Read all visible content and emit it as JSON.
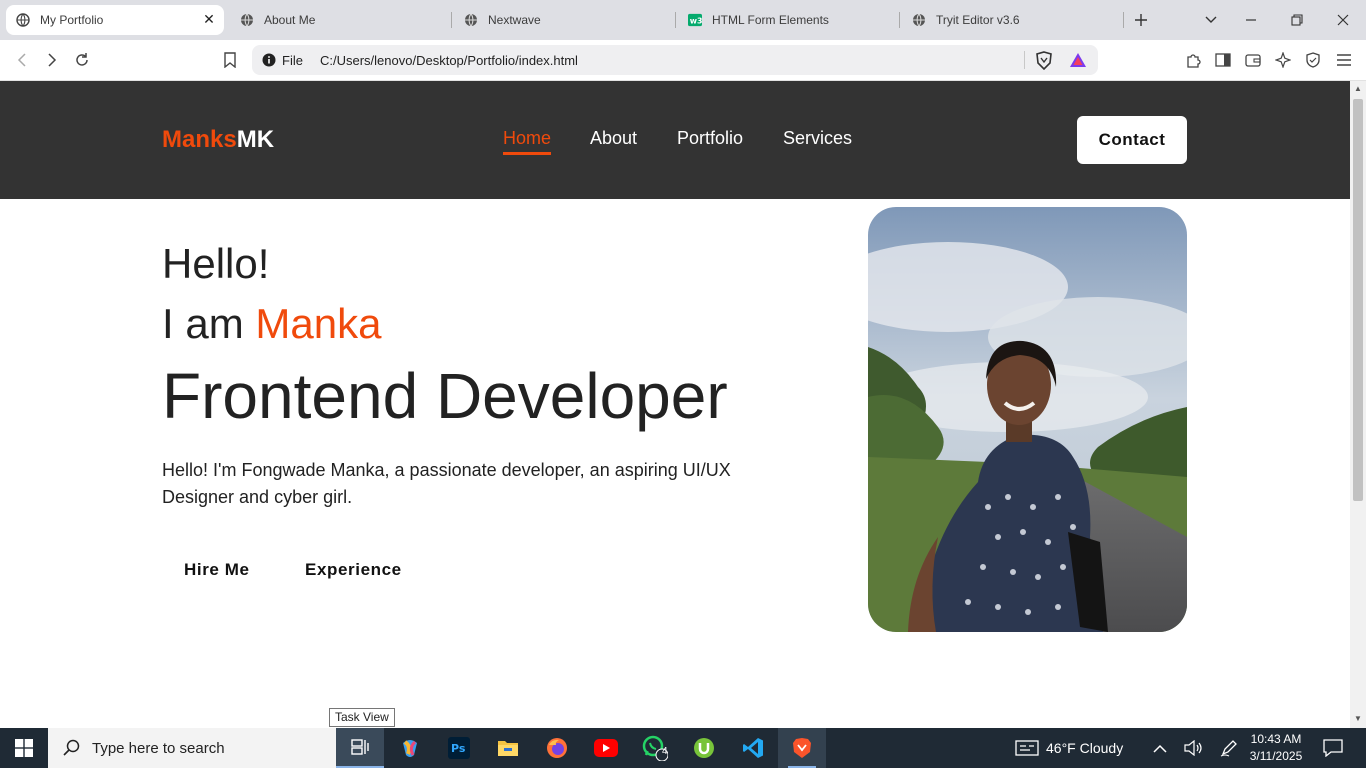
{
  "browser": {
    "tabs": [
      {
        "label": "My Portfolio",
        "active": true
      },
      {
        "label": "About Me",
        "active": false
      },
      {
        "label": "Nextwave",
        "active": false
      },
      {
        "label": "HTML Form Elements",
        "active": false
      },
      {
        "label": "Tryit Editor v3.6",
        "active": false
      }
    ],
    "url_scheme": "File",
    "url": "C:/Users/lenovo/Desktop/Portfolio/index.html"
  },
  "site": {
    "logo_part1": "Manks",
    "logo_part2": "MK",
    "nav": [
      {
        "label": "Home",
        "active": true
      },
      {
        "label": "About",
        "active": false
      },
      {
        "label": "Portfolio",
        "active": false
      },
      {
        "label": "Services",
        "active": false
      }
    ],
    "contact_label": "Contact",
    "accent_color": "#f04a0c",
    "header_bg": "#333333"
  },
  "hero": {
    "greeting": "Hello!",
    "iam_prefix": "I am ",
    "name": "Manka",
    "role": "Frontend Developer",
    "intro": "Hello! I'm Fongwade Manka, a passionate developer, an aspiring UI/UX Designer and cyber girl.",
    "hire_label": "Hire Me",
    "experience_label": "Experience"
  },
  "tooltip": "Task View",
  "taskbar": {
    "search_placeholder": "Type here to search",
    "whatsapp_badge": "4",
    "weather": "46°F  Cloudy",
    "time": "10:43 AM",
    "date": "3/11/2025"
  }
}
